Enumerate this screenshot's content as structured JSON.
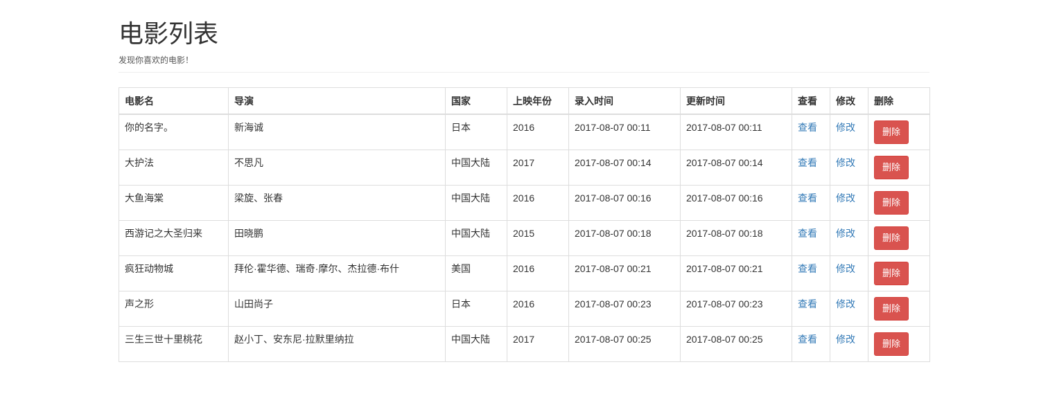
{
  "header": {
    "title": "电影列表",
    "subtitle": "发现你喜欢的电影！"
  },
  "table": {
    "columns": [
      "电影名",
      "导演",
      "国家",
      "上映年份",
      "录入时间",
      "更新时间",
      "查看",
      "修改",
      "删除"
    ],
    "rows": [
      {
        "name": "你的名字。",
        "director": "新海诚",
        "country": "日本",
        "year": "2016",
        "created": "2017-08-07 00:11",
        "updated": "2017-08-07 00:11",
        "view": "查看",
        "edit": "修改",
        "delete": "删除"
      },
      {
        "name": "大护法",
        "director": "不思凡",
        "country": "中国大陆",
        "year": "2017",
        "created": "2017-08-07 00:14",
        "updated": "2017-08-07 00:14",
        "view": "查看",
        "edit": "修改",
        "delete": "删除"
      },
      {
        "name": "大鱼海棠",
        "director": "梁旋、张春",
        "country": "中国大陆",
        "year": "2016",
        "created": "2017-08-07 00:16",
        "updated": "2017-08-07 00:16",
        "view": "查看",
        "edit": "修改",
        "delete": "删除"
      },
      {
        "name": "西游记之大圣归来",
        "director": "田晓鹏",
        "country": "中国大陆",
        "year": "2015",
        "created": "2017-08-07 00:18",
        "updated": "2017-08-07 00:18",
        "view": "查看",
        "edit": "修改",
        "delete": "删除"
      },
      {
        "name": "疯狂动物城",
        "director": "拜伦·霍华德、瑞奇·摩尔、杰拉德·布什",
        "country": "美国",
        "year": "2016",
        "created": "2017-08-07 00:21",
        "updated": "2017-08-07 00:21",
        "view": "查看",
        "edit": "修改",
        "delete": "删除"
      },
      {
        "name": "声之形",
        "director": "山田尚子",
        "country": "日本",
        "year": "2016",
        "created": "2017-08-07 00:23",
        "updated": "2017-08-07 00:23",
        "view": "查看",
        "edit": "修改",
        "delete": "删除"
      },
      {
        "name": "三生三世十里桃花",
        "director": "赵小丁、安东尼·拉默里纳拉",
        "country": "中国大陆",
        "year": "2017",
        "created": "2017-08-07 00:25",
        "updated": "2017-08-07 00:25",
        "view": "查看",
        "edit": "修改",
        "delete": "删除"
      }
    ]
  },
  "colors": {
    "link": "#337ab7",
    "danger": "#d9534f",
    "border": "#dddddd"
  }
}
